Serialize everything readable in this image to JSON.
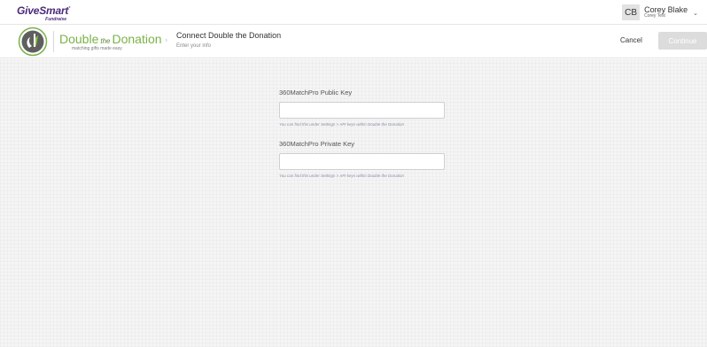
{
  "brand": {
    "name": "GiveSmart",
    "trademark": "°",
    "sub": "Fundraise",
    "color": "#4a2a78"
  },
  "user": {
    "initials": "CB",
    "name": "Corey Blake",
    "org": "Corey Test",
    "caret_icon": "chevron-down-icon"
  },
  "integration": {
    "logo_word_left": "Double",
    "logo_word_the": "the",
    "logo_word_right": "Donation",
    "tagline": "matching gifts made easy",
    "accent_color": "#7ab246"
  },
  "header": {
    "title": "Connect Double the Donation",
    "subtitle": "Enter your info",
    "cancel_label": "Cancel",
    "continue_label": "Continue"
  },
  "form": {
    "public_key": {
      "label": "360MatchPro Public Key",
      "value": "",
      "placeholder": "",
      "help": "You can find this under Settings > API keys within Double the Donation"
    },
    "private_key": {
      "label": "360MatchPro Private Key",
      "value": "",
      "placeholder": "",
      "help": "You can find this under Settings > API keys within Double the Donation"
    }
  }
}
